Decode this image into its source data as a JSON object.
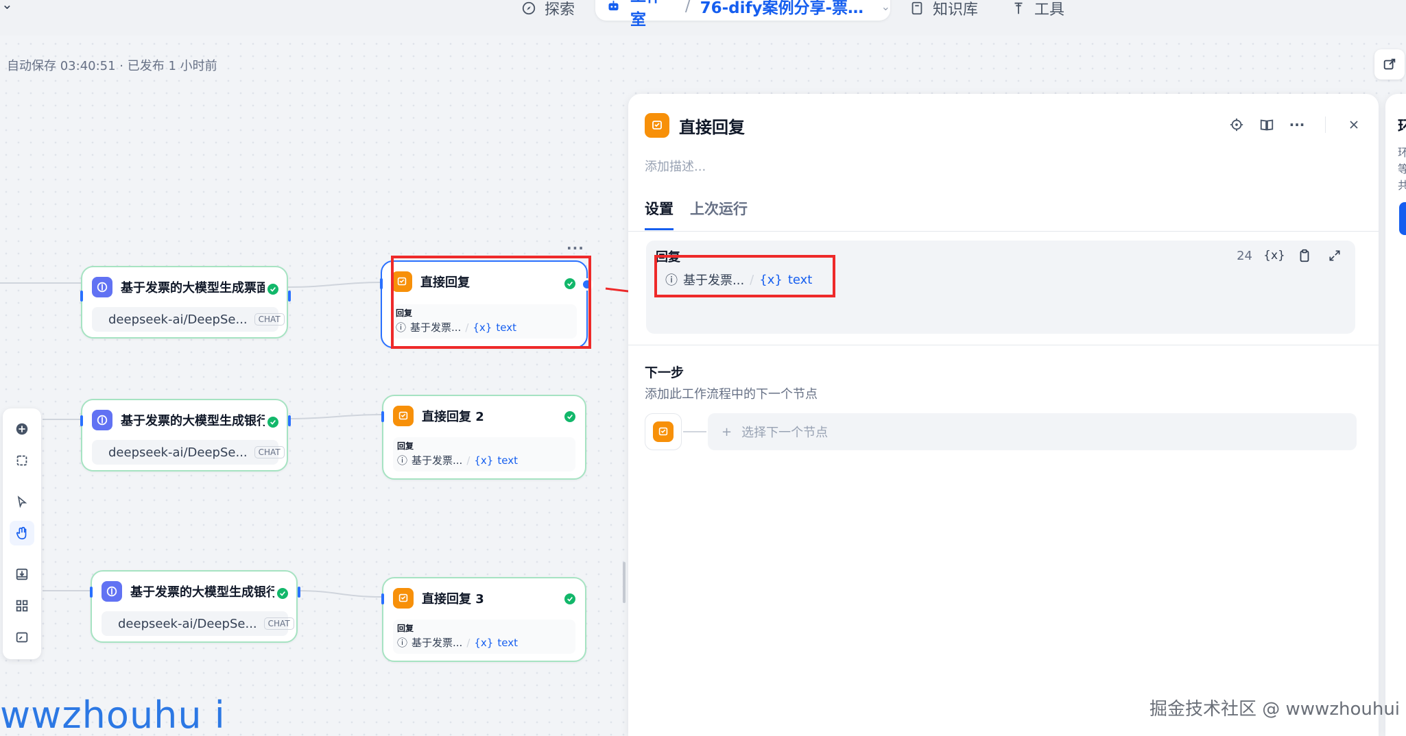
{
  "nav": {
    "explore": "探索",
    "studio": "工作室",
    "app_title": "76-dify案例分享-票据...",
    "knowledge": "知识库",
    "tools": "工具"
  },
  "autosave": "自动保存 03:40:51 · 已发布 1 小时前",
  "llm_nodes": [
    {
      "title": "基于发票的大模型生成票面信",
      "model": "deepseek-ai/DeepSe...",
      "tag": "CHAT"
    },
    {
      "title": "基于发票的大模型生成银行凭",
      "model": "deepseek-ai/DeepSe...",
      "tag": "CHAT"
    },
    {
      "title": "基于发票的大模型生成银行信",
      "model": "deepseek-ai/DeepSe...",
      "tag": "CHAT"
    }
  ],
  "answer_nodes": [
    {
      "title": "直接回复",
      "label": "回复",
      "var_source": "基于发票...",
      "var_name": "text"
    },
    {
      "title": "直接回复 2",
      "label": "回复",
      "var_source": "基于发票...",
      "var_name": "text"
    },
    {
      "title": "直接回复 3",
      "label": "回复",
      "var_source": "基于发票...",
      "var_name": "text"
    }
  ],
  "node_more": "···",
  "panel": {
    "title": "直接回复",
    "description_placeholder": "添加描述...",
    "tabs": [
      "设置",
      "上次运行"
    ],
    "editor": {
      "label": "回复",
      "char_count": "24",
      "var_icon": "{x}",
      "var_source": "基于发票...",
      "var_name": "text"
    },
    "next_step": {
      "title": "下一步",
      "description": "添加此工作流程中的下一个节点",
      "select_label": "选择下一个节点",
      "plus": "+"
    }
  },
  "right_panel": {
    "title": "环",
    "lines": [
      "环",
      "等",
      "共"
    ]
  },
  "watermark_left": "wwzhouhu i",
  "watermark_right": "掘金技术社区 @ wwwzhouhui",
  "colors": {
    "accent": "#155eef",
    "answer_icon": "#f79009",
    "llm_icon": "#6172f3",
    "success": "#12b76a",
    "annotation_red": "#ee2a2a"
  }
}
